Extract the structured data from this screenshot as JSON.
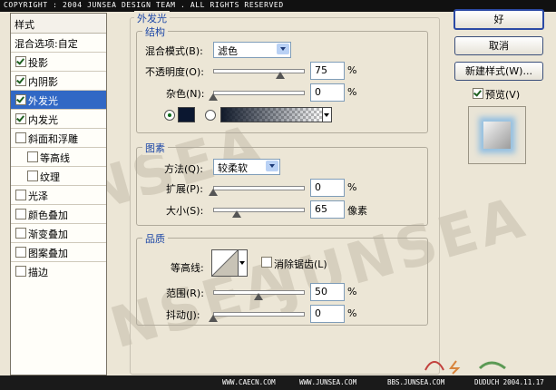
{
  "header": {
    "text": "COPYRIGHT : 2004 JUNSEA DESIGN TEAM . ALL RIGHTS RESERVED"
  },
  "footer": {
    "items": [
      "WWW.CAECN.COM",
      "WWW.JUNSEA.COM",
      "BBS.JUNSEA.COM",
      "DUDUCH 2004.11.17"
    ]
  },
  "watermark": {
    "text": "JUNSEA"
  },
  "styles_list": {
    "title": "样式",
    "blend_options": "混合选项:自定",
    "items": [
      {
        "label": "投影",
        "checked": true
      },
      {
        "label": "内阴影",
        "checked": true
      },
      {
        "label": "外发光",
        "checked": true,
        "selected": true
      },
      {
        "label": "内发光",
        "checked": true
      },
      {
        "label": "斜面和浮雕",
        "checked": false
      },
      {
        "label": "等高线",
        "checked": false
      },
      {
        "label": "纹理",
        "checked": false
      },
      {
        "label": "光泽",
        "checked": false
      },
      {
        "label": "颜色叠加",
        "checked": false
      },
      {
        "label": "渐变叠加",
        "checked": false
      },
      {
        "label": "图案叠加",
        "checked": false
      },
      {
        "label": "描边",
        "checked": false
      }
    ]
  },
  "panel": {
    "title": "外发光",
    "structure": {
      "title": "结构",
      "blend_mode_label": "混合模式(B):",
      "blend_mode_value": "滤色",
      "opacity_label": "不透明度(O):",
      "opacity_value": "75",
      "opacity_unit": "%",
      "opacity_fraction": 0.75,
      "noise_label": "杂色(N):",
      "noise_value": "0",
      "noise_unit": "%",
      "noise_fraction": 0,
      "glow_color": "#0b1730"
    },
    "elements": {
      "title": "图素",
      "method_label": "方法(Q):",
      "method_value": "较柔软",
      "spread_label": "扩展(P):",
      "spread_value": "0",
      "spread_unit": "%",
      "spread_fraction": 0,
      "size_label": "大小(S):",
      "size_value": "65",
      "size_unit": "像素",
      "size_fraction": 0.26
    },
    "quality": {
      "title": "品质",
      "contour_label": "等高线:",
      "antialias_label": "消除锯齿(L)",
      "antialias_checked": false,
      "range_label": "范围(R):",
      "range_value": "50",
      "range_unit": "%",
      "range_fraction": 0.5,
      "jitter_label": "抖动(J):",
      "jitter_value": "0",
      "jitter_unit": "%",
      "jitter_fraction": 0
    }
  },
  "buttons": {
    "ok": "好",
    "cancel": "取消",
    "new_style": "新建样式(W)...",
    "preview_label": "预览(V)",
    "preview_checked": true
  }
}
